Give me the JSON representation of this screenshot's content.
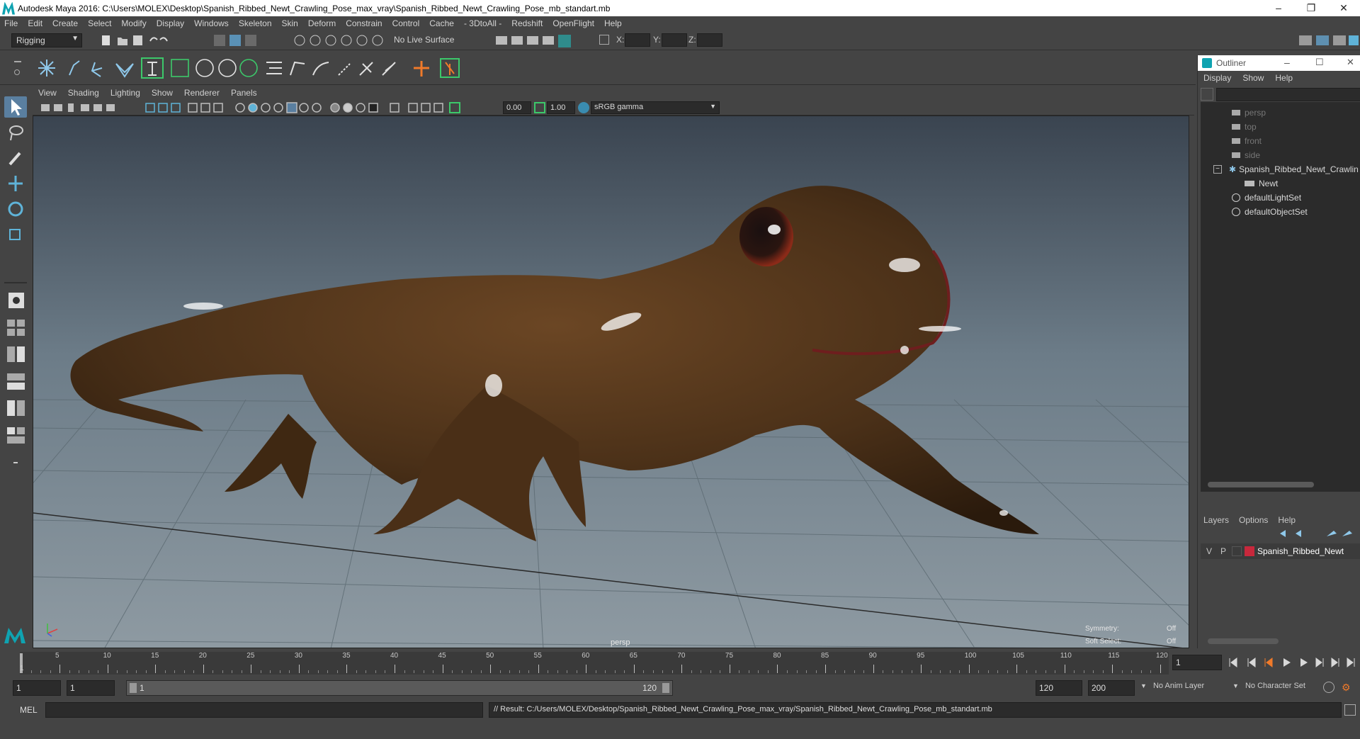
{
  "window": {
    "title": "Autodesk Maya 2016: C:\\Users\\MOLEX\\Desktop\\Spanish_Ribbed_Newt_Crawling_Pose_max_vray\\Spanish_Ribbed_Newt_Crawling_Pose_mb_standart.mb",
    "minimize": "–",
    "restore": "❐",
    "close": "✕"
  },
  "menubar": [
    "File",
    "Edit",
    "Create",
    "Select",
    "Modify",
    "Display",
    "Windows",
    "Skeleton",
    "Skin",
    "Deform",
    "Constrain",
    "Control",
    "Cache",
    "- 3DtoAll -",
    "Redshift",
    "OpenFlight",
    "Help"
  ],
  "statusline": {
    "menuset": "Rigging",
    "live_surface": "No Live Surface",
    "x_label": "X:",
    "y_label": "Y:",
    "z_label": "Z:"
  },
  "panel": {
    "menu": [
      "View",
      "Shading",
      "Lighting",
      "Show",
      "Renderer",
      "Panels"
    ],
    "exposure": "0.00",
    "gamma": "1.00",
    "color_space": "sRGB gamma",
    "camera_label": "persp",
    "symmetry_label": "Symmetry:",
    "symmetry_value": "Off",
    "soft_select_label": "Soft Select:",
    "soft_select_value": "Off"
  },
  "outliner": {
    "title": "Outliner",
    "menu": [
      "Display",
      "Show",
      "Help"
    ],
    "items": [
      {
        "label": "persp",
        "type": "camera"
      },
      {
        "label": "top",
        "type": "camera"
      },
      {
        "label": "front",
        "type": "camera"
      },
      {
        "label": "side",
        "type": "camera"
      },
      {
        "label": "Spanish_Ribbed_Newt_Crawlin",
        "type": "group",
        "expand": "−"
      },
      {
        "label": "Newt",
        "type": "mesh"
      },
      {
        "label": "defaultLightSet",
        "type": "set"
      },
      {
        "label": "defaultObjectSet",
        "type": "set"
      }
    ]
  },
  "layers": {
    "menu": [
      "Layers",
      "Options",
      "Help"
    ],
    "row": {
      "v": "V",
      "p": "P",
      "name": "Spanish_Ribbed_Newt",
      "color": "#c8283c"
    }
  },
  "timeline": {
    "ticks": [
      "5",
      "10",
      "15",
      "20",
      "25",
      "30",
      "35",
      "40",
      "45",
      "50",
      "55",
      "60",
      "65",
      "70",
      "75",
      "80",
      "85",
      "90",
      "95",
      "100",
      "105",
      "110",
      "115",
      "120"
    ],
    "start_label": "1",
    "current_frame": "1"
  },
  "range": {
    "start": "1",
    "playback_start": "1",
    "slider_start": "1",
    "slider_end": "120",
    "playback_end": "120",
    "end": "200",
    "anim_layer": "No Anim Layer",
    "character_set": "No Character Set"
  },
  "command": {
    "lang": "MEL",
    "result": "// Result: C:/Users/MOLEX/Desktop/Spanish_Ribbed_Newt_Crawling_Pose_max_vray/Spanish_Ribbed_Newt_Crawling_Pose_mb_standart.mb"
  },
  "colors": {
    "accent": "#5fb3d8",
    "ui_bg": "#444444",
    "field_bg": "#2b2b2b",
    "newt_body": "#4a3018"
  }
}
